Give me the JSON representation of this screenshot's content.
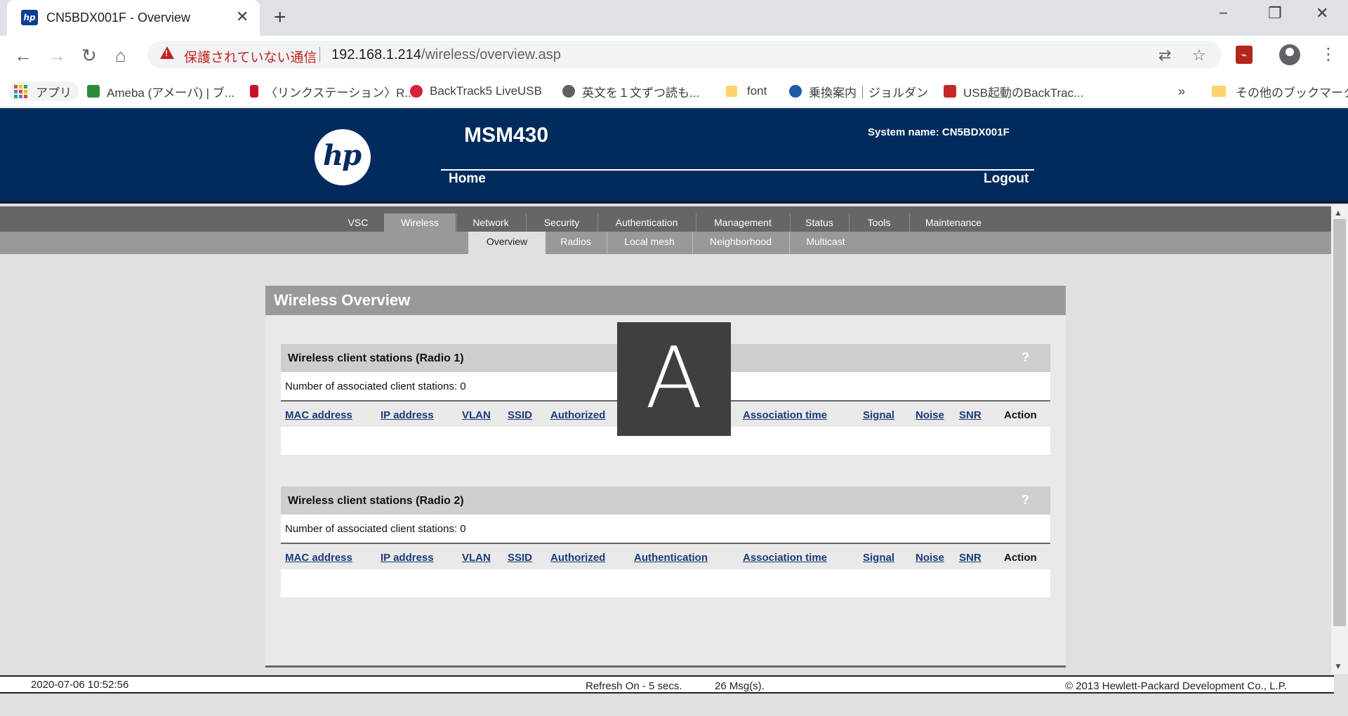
{
  "browser": {
    "tab_title": "CN5BDX001F - Overview",
    "tab_favicon": "hp",
    "new_tab": "+",
    "window_minimize": "−",
    "window_restore": "❐",
    "window_close": "✕",
    "security_warning": "保護されていない通信",
    "url_host": "192.168.1.214",
    "url_path": "/wireless/overview.asp",
    "bookmarks": [
      {
        "label": "アプリ"
      },
      {
        "label": "Ameba (アメーバ) | ブ..."
      },
      {
        "label": "〈リンクステーション〉R..."
      },
      {
        "label": "BackTrack5 LiveUSB"
      },
      {
        "label": "英文を１文ずつ読も..."
      },
      {
        "label": "font"
      },
      {
        "label": "乗換案内｜ジョルダン"
      },
      {
        "label": "USB起動のBackTrac..."
      }
    ],
    "bookmarks_overflow": "»",
    "other_bookmarks": "その他のブックマーク"
  },
  "header": {
    "logo_text": "hp",
    "product": "MSM430",
    "system_name": "System name: CN5BDX001F",
    "home": "Home",
    "logout": "Logout"
  },
  "main_nav": [
    {
      "label": "VSC"
    },
    {
      "label": "Wireless"
    },
    {
      "label": "Network"
    },
    {
      "label": "Security"
    },
    {
      "label": "Authentication"
    },
    {
      "label": "Management"
    },
    {
      "label": "Status"
    },
    {
      "label": "Tools"
    },
    {
      "label": "Maintenance"
    }
  ],
  "main_nav_selected": "Wireless",
  "sub_nav": [
    {
      "label": "Overview"
    },
    {
      "label": "Radios"
    },
    {
      "label": "Local mesh"
    },
    {
      "label": "Neighborhood"
    },
    {
      "label": "Multicast"
    }
  ],
  "sub_nav_selected": "Overview",
  "panel": {
    "title": "Wireless Overview",
    "sections": [
      {
        "title": "Wireless client stations (Radio 1)",
        "help": "?",
        "count_text": "Number of associated client stations: 0"
      },
      {
        "title": "Wireless client stations (Radio 2)",
        "help": "?",
        "count_text": "Number of associated client stations: 0"
      }
    ],
    "columns": [
      "MAC address",
      "IP address",
      "VLAN",
      "SSID",
      "Authorized",
      "Authentication",
      "Association time",
      "Signal",
      "Noise",
      "SNR",
      "Action"
    ]
  },
  "overlay_letter": "A",
  "status": {
    "datetime": "2020-07-06 10:52:56",
    "refresh": "Refresh On - 5 secs.",
    "messages": "26 Msg(s).",
    "copyright": "© 2013 Hewlett-Packard Development Co., L.P."
  },
  "colors": {
    "banner": "#002b5c",
    "link": "#1a3b7a",
    "warning": "#c5221f"
  }
}
